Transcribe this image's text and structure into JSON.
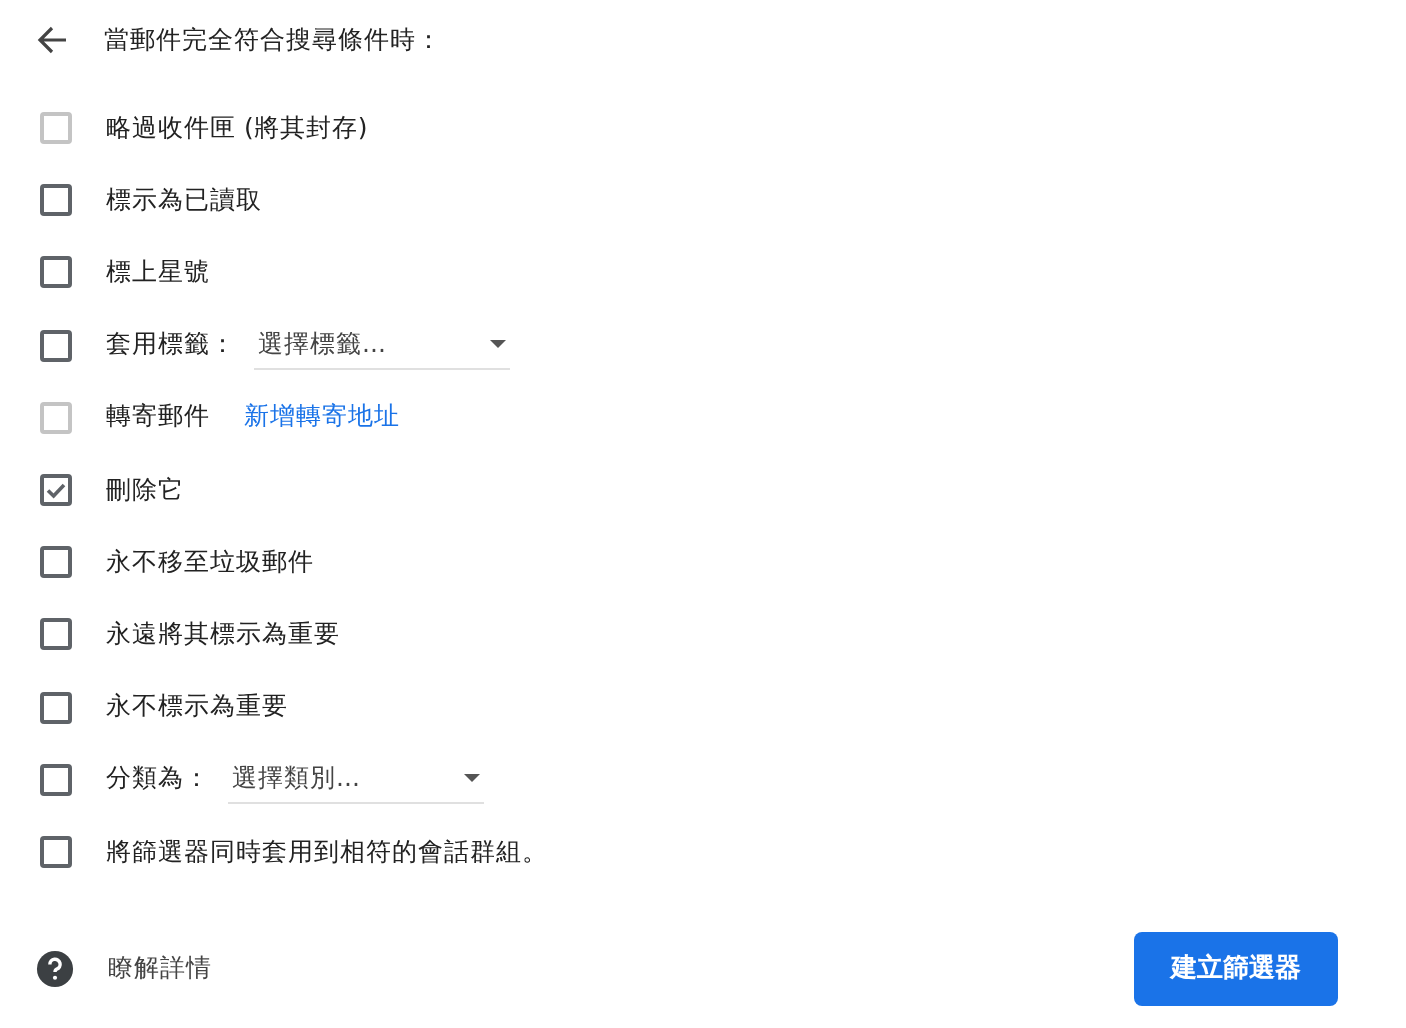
{
  "header": {
    "title": "當郵件完全符合搜尋條件時："
  },
  "options": [
    {
      "kind": "plain",
      "label": "略過收件匣 (將其封存)",
      "checked": false,
      "disabled": true
    },
    {
      "kind": "plain",
      "label": "標示為已讀取",
      "checked": false,
      "disabled": false
    },
    {
      "kind": "plain",
      "label": "標上星號",
      "checked": false,
      "disabled": false
    },
    {
      "kind": "dropdown",
      "label": "套用標籤：",
      "placeholder": "選擇標籤...",
      "checked": false,
      "disabled": false
    },
    {
      "kind": "link",
      "label": "轉寄郵件",
      "link": "新增轉寄地址",
      "checked": false,
      "disabled": true
    },
    {
      "kind": "plain",
      "label": "刪除它",
      "checked": true,
      "disabled": false
    },
    {
      "kind": "plain",
      "label": "永不移至垃圾郵件",
      "checked": false,
      "disabled": false
    },
    {
      "kind": "plain",
      "label": "永遠將其標示為重要",
      "checked": false,
      "disabled": false
    },
    {
      "kind": "plain",
      "label": "永不標示為重要",
      "checked": false,
      "disabled": false
    },
    {
      "kind": "dropdown",
      "label": "分類為：",
      "placeholder": "選擇類別...",
      "checked": false,
      "disabled": false
    },
    {
      "kind": "plain",
      "label": "將篩選器同時套用到相符的會話群組。",
      "checked": false,
      "disabled": false
    }
  ],
  "footer": {
    "help": "瞭解詳情",
    "button": "建立篩選器"
  }
}
